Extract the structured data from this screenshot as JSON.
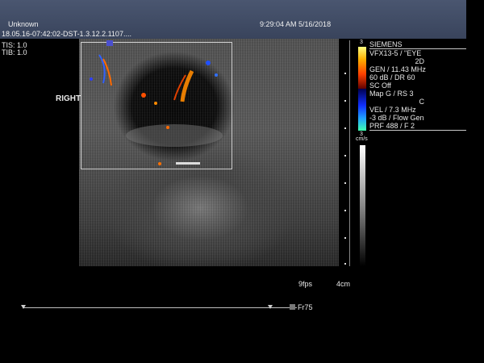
{
  "header": {
    "patient": "Unknown",
    "datetime": "9:29:04 AM 5/16/2018",
    "study_id": "18.05.16-07:42:02-DST-1.3.12.2.1107...."
  },
  "indices": {
    "tis": "TIS: 1.0",
    "tib": "TIB: 1.0"
  },
  "orientation_label": "RIGHT",
  "panel": {
    "scale_top": "3",
    "brand": "SIEMENS",
    "probe": "VFX13-5 / \"EYE",
    "mode_2d": "2D",
    "gen": "GEN / 11.43 MHz",
    "db": "60 dB / DR 60",
    "sc": "SC Off",
    "map": "Map G / RS 3",
    "mode_c": "C",
    "vel": "VEL / 7.3 MHz",
    "flow": "-3 dB / Flow Gen",
    "prf": "PRF 488 / F 2",
    "scale_bottom": "3",
    "unit": "cm/s"
  },
  "footer": {
    "fps": "9fps",
    "depth": "4cm",
    "frame": "Fr75"
  },
  "colors": {
    "header": "#3f4a62",
    "velocity_high": "#ff8a00",
    "velocity_low": "#1c4cff"
  }
}
